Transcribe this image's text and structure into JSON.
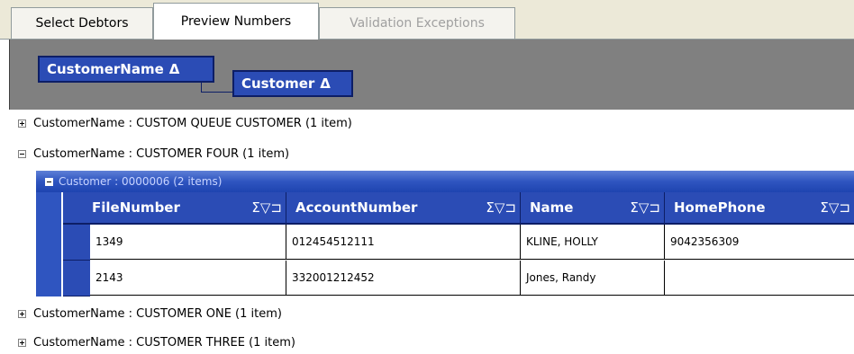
{
  "tabs": [
    {
      "label": "Select Debtors",
      "state": "normal"
    },
    {
      "label": "Preview Numbers",
      "state": "active"
    },
    {
      "label": "Validation Exceptions",
      "state": "disabled"
    }
  ],
  "group_by": {
    "chips": [
      {
        "label": "CustomerName",
        "sort_glyph": "Δ"
      },
      {
        "label": "Customer",
        "sort_glyph": "Δ"
      }
    ]
  },
  "groups_top": [
    {
      "text": "CustomerName : CUSTOM QUEUE CUSTOMER (1 item)",
      "expanded": false
    },
    {
      "text": "CustomerName : CUSTOMER FOUR (1 item)",
      "expanded": true
    }
  ],
  "subgroup": {
    "text": "Customer : 0000006 (2 items)"
  },
  "grid": {
    "columns": [
      "FileNumber",
      "AccountNumber",
      "Name",
      "HomePhone"
    ],
    "column_icons": "Σ▽⊐",
    "rows": [
      [
        "1349",
        "012454512111",
        "KLINE, HOLLY",
        "9042356309"
      ],
      [
        "2143",
        "332001212452",
        "Jones, Randy",
        ""
      ]
    ]
  },
  "groups_bottom": [
    {
      "text": "CustomerName : CUSTOMER ONE (1 item)",
      "expanded": false
    },
    {
      "text": "CustomerName : CUSTOMER THREE (1 item)",
      "expanded": false
    }
  ],
  "colors": {
    "header_blue": "#2b4cb5",
    "group_area_gray": "#808080",
    "band_blue": "#2f55c0"
  }
}
